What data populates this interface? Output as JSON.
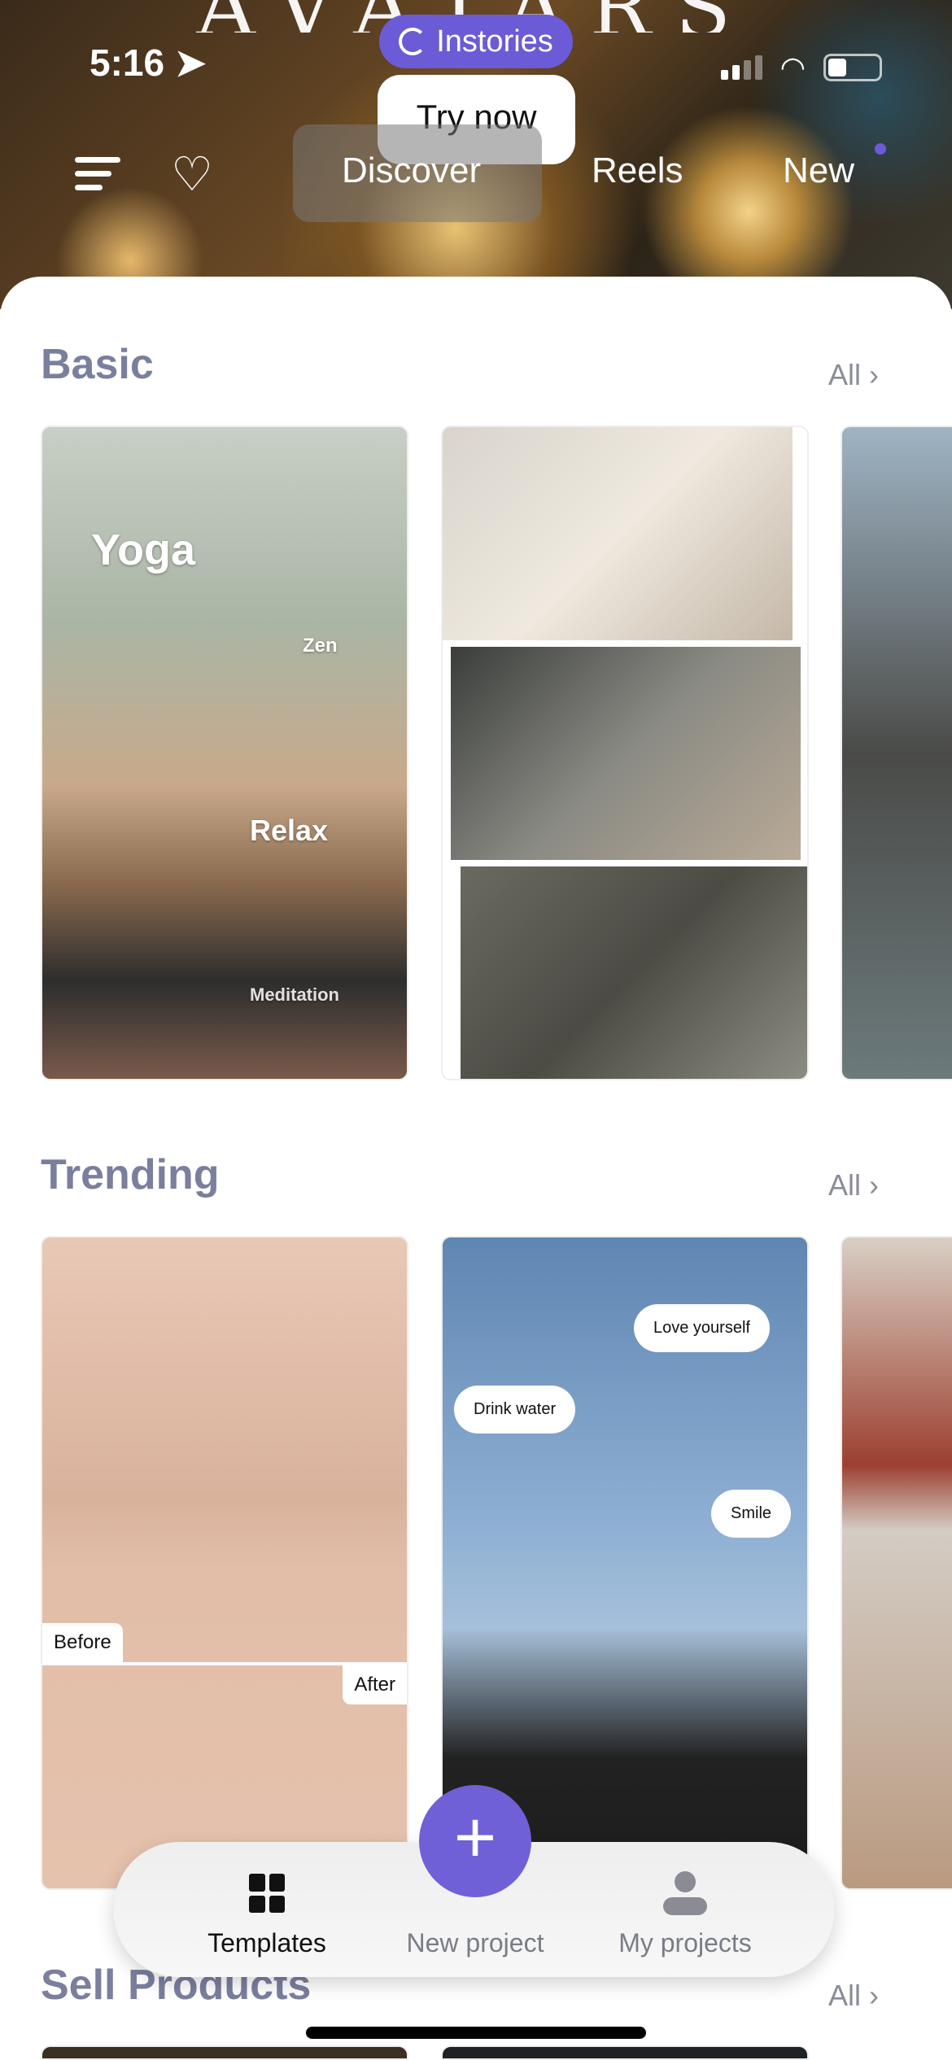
{
  "hero": {
    "title": "AVATARS"
  },
  "status_bar": {
    "time": "5:16"
  },
  "promo": {
    "badge": "Instories",
    "button": "Try now"
  },
  "top_nav": {
    "tabs": [
      "Discover",
      "Reels",
      "New"
    ],
    "active": "Discover"
  },
  "sections": [
    {
      "title": "Basic",
      "all_label": "All",
      "cards": [
        {
          "overlay": [
            "Yoga",
            "Zen",
            "Relax",
            "Meditation"
          ]
        },
        {},
        {}
      ]
    },
    {
      "title": "Trending",
      "all_label": "All",
      "cards": [
        {
          "tags": [
            "Before",
            "After"
          ]
        },
        {
          "bubbles": [
            "Love yourself",
            "Drink water",
            "Smile"
          ]
        },
        {}
      ]
    },
    {
      "title": "Sell Products",
      "all_label": "All"
    }
  ],
  "bottom_nav": {
    "items": [
      "Templates",
      "New project",
      "My projects"
    ],
    "active": "Templates"
  },
  "colors": {
    "accent": "#6f60d8",
    "section_title": "#7a7f9e"
  }
}
